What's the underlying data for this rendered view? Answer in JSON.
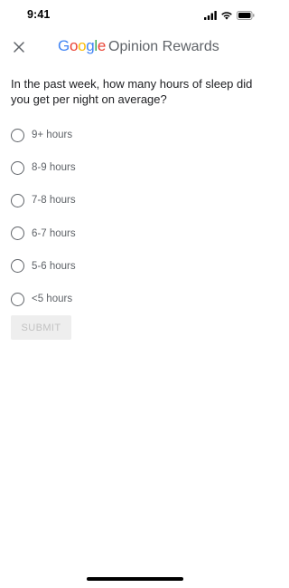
{
  "status_bar": {
    "time": "9:41",
    "icons": [
      "signal-icon",
      "wifi-icon",
      "battery-icon"
    ]
  },
  "header": {
    "close_icon": "close-icon",
    "brand": {
      "letters": [
        {
          "char": "G",
          "color": "#4285F4"
        },
        {
          "char": "o",
          "color": "#EA4335"
        },
        {
          "char": "o",
          "color": "#FBBC05"
        },
        {
          "char": "g",
          "color": "#4285F4"
        },
        {
          "char": "l",
          "color": "#34A853"
        },
        {
          "char": "e",
          "color": "#EA4335"
        }
      ],
      "product": "Opinion Rewards"
    }
  },
  "question": {
    "text": "In the past week, how many hours of sleep did you get per night on average?"
  },
  "options": [
    {
      "label": "9+ hours",
      "selected": false
    },
    {
      "label": "8-9 hours",
      "selected": false
    },
    {
      "label": "7-8 hours",
      "selected": false
    },
    {
      "label": "6-7 hours",
      "selected": false
    },
    {
      "label": "5-6 hours",
      "selected": false
    },
    {
      "label": "<5 hours",
      "selected": false
    }
  ],
  "submit": {
    "label": "SUBMIT",
    "enabled": false
  },
  "colors": {
    "text_primary": "#202124",
    "text_secondary": "#5f6368",
    "button_disabled_bg": "#eeeeee",
    "button_disabled_text": "#c2c2c2"
  }
}
